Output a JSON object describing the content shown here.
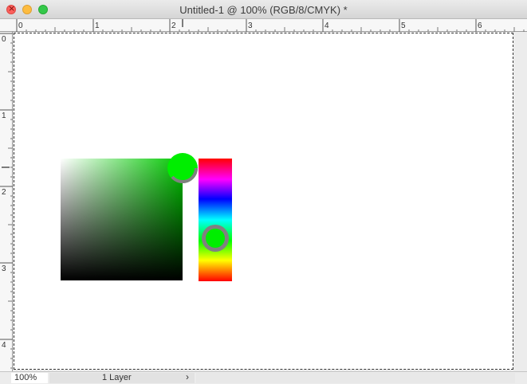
{
  "window": {
    "title": "Untitled-1 @ 100% (RGB/8/CMYK) *",
    "buttons": {
      "close": "close-icon",
      "minimize": "minimize-icon",
      "maximize": "zoom-icon"
    }
  },
  "rulers": {
    "top_labels": [
      "0",
      "1",
      "2",
      "3",
      "4",
      "5",
      "6"
    ],
    "left_labels": [
      "0",
      "1",
      "2",
      "3",
      "4"
    ]
  },
  "color_picker": {
    "hue_color": "#00ff00",
    "selected_color": "#00ee00",
    "hue_stops": [
      "#ff0000",
      "#ff00ff",
      "#0000ff",
      "#00ffff",
      "#00ff00",
      "#ffff00",
      "#ff0000"
    ],
    "ring_color": "#808080"
  },
  "status": {
    "zoom": "100%",
    "doc_info": "1 Layer",
    "doc_info_arrow": "›"
  }
}
